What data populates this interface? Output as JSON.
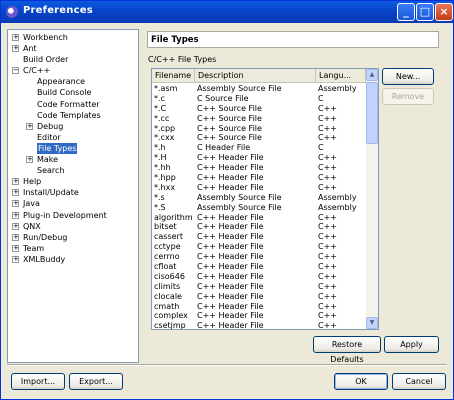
{
  "window": {
    "title": "Preferences"
  },
  "tree": [
    {
      "label": "Workbench",
      "indent": 0,
      "expander": "+"
    },
    {
      "label": "Ant",
      "indent": 0,
      "expander": "+"
    },
    {
      "label": "Build Order",
      "indent": 0,
      "expander": ""
    },
    {
      "label": "C/C++",
      "indent": 0,
      "expander": "−"
    },
    {
      "label": "Appearance",
      "indent": 1,
      "expander": ""
    },
    {
      "label": "Build Console",
      "indent": 1,
      "expander": ""
    },
    {
      "label": "Code Formatter",
      "indent": 1,
      "expander": ""
    },
    {
      "label": "Code Templates",
      "indent": 1,
      "expander": ""
    },
    {
      "label": "Debug",
      "indent": 1,
      "expander": "+"
    },
    {
      "label": "Editor",
      "indent": 1,
      "expander": ""
    },
    {
      "label": "File Types",
      "indent": 1,
      "expander": "",
      "selected": true
    },
    {
      "label": "Make",
      "indent": 1,
      "expander": "+"
    },
    {
      "label": "Search",
      "indent": 1,
      "expander": ""
    },
    {
      "label": "Help",
      "indent": 0,
      "expander": "+"
    },
    {
      "label": "Install/Update",
      "indent": 0,
      "expander": "+"
    },
    {
      "label": "Java",
      "indent": 0,
      "expander": "+"
    },
    {
      "label": "Plug-in Development",
      "indent": 0,
      "expander": "+"
    },
    {
      "label": "QNX",
      "indent": 0,
      "expander": "+"
    },
    {
      "label": "Run/Debug",
      "indent": 0,
      "expander": "+"
    },
    {
      "label": "Team",
      "indent": 0,
      "expander": "+"
    },
    {
      "label": "XMLBuddy",
      "indent": 0,
      "expander": "+"
    }
  ],
  "page": {
    "title": "File Types",
    "section_label": "C/C++ File Types"
  },
  "table": {
    "columns": [
      "Filename",
      "Description",
      "Langu..."
    ],
    "rows": [
      [
        "*.asm",
        "Assembly Source File",
        "Assembly"
      ],
      [
        "*.c",
        "C Source File",
        "C"
      ],
      [
        "*.C",
        "C++ Source File",
        "C++"
      ],
      [
        "*.cc",
        "C++ Source File",
        "C++"
      ],
      [
        "*.cpp",
        "C++ Source File",
        "C++"
      ],
      [
        "*.cxx",
        "C++ Source File",
        "C++"
      ],
      [
        "*.h",
        "C Header File",
        "C"
      ],
      [
        "*.H",
        "C++ Header File",
        "C++"
      ],
      [
        "*.hh",
        "C++ Header File",
        "C++"
      ],
      [
        "*.hpp",
        "C++ Header File",
        "C++"
      ],
      [
        "*.hxx",
        "C++ Header File",
        "C++"
      ],
      [
        "*.s",
        "Assembly Source File",
        "Assembly"
      ],
      [
        "*.S",
        "Assembly Source File",
        "Assembly"
      ],
      [
        "algorithm",
        "C++ Header File",
        "C++"
      ],
      [
        "bitset",
        "C++ Header File",
        "C++"
      ],
      [
        "cassert",
        "C++ Header File",
        "C++"
      ],
      [
        "cctype",
        "C++ Header File",
        "C++"
      ],
      [
        "cerrno",
        "C++ Header File",
        "C++"
      ],
      [
        "cfloat",
        "C++ Header File",
        "C++"
      ],
      [
        "ciso646",
        "C++ Header File",
        "C++"
      ],
      [
        "climits",
        "C++ Header File",
        "C++"
      ],
      [
        "clocale",
        "C++ Header File",
        "C++"
      ],
      [
        "cmath",
        "C++ Header File",
        "C++"
      ],
      [
        "complex",
        "C++ Header File",
        "C++"
      ],
      [
        "csetjmp",
        "C++ Header File",
        "C++"
      ]
    ]
  },
  "buttons": {
    "new": "New...",
    "remove": "Remove",
    "restore_defaults": "Restore Defaults",
    "apply": "Apply",
    "import": "Import...",
    "export": "Export...",
    "ok": "OK",
    "cancel": "Cancel"
  },
  "colors": {
    "selection": "#316ac5",
    "titlebar": "#0a5ae0"
  }
}
